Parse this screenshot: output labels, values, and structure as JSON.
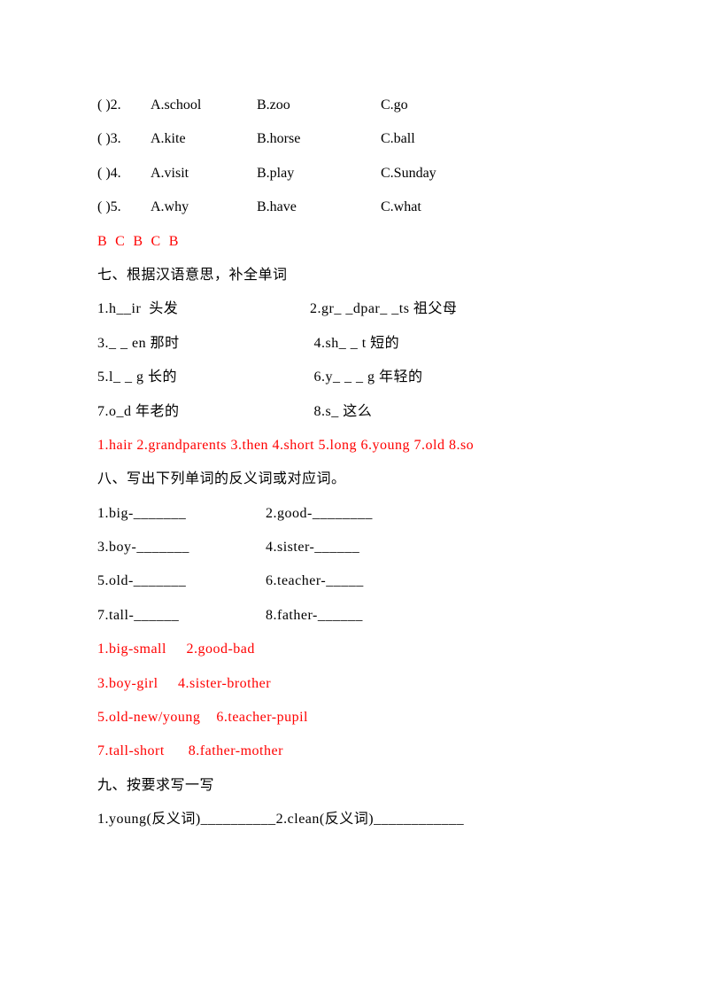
{
  "mcq": {
    "rows": [
      {
        "prefix": "( )2.",
        "a": "A.school",
        "b": "B.zoo",
        "c": "C.go"
      },
      {
        "prefix": "( )3.",
        "a": "A.kite",
        "b": "B.horse",
        "c": "C.ball"
      },
      {
        "prefix": "( )4.",
        "a": "A.visit",
        "b": "B.play",
        "c": "C.Sunday"
      },
      {
        "prefix": "( )5.",
        "a": "A.why",
        "b": "B.have",
        "c": "C.what"
      }
    ],
    "answer": "B  C  B  C  B"
  },
  "section7": {
    "title": "七、根据汉语意思，补全单词",
    "rows": [
      {
        "left": "1.h__ir  头发",
        "right": "2.gr_ _dpar_ _ts 祖父母"
      },
      {
        "left": "3._ _ en 那时",
        "right": " 4.sh_ _ t 短的"
      },
      {
        "left": "5.l_ _ g 长的",
        "right": " 6.y_ _ _ g 年轻的"
      },
      {
        "left": "7.o_d 年老的",
        "right": " 8.s_ 这么"
      }
    ],
    "answer": "1.hair 2.grandparents 3.then 4.short 5.long 6.young 7.old 8.so"
  },
  "section8": {
    "title": "八、写出下列单词的反义词或对应词。",
    "rows": [
      {
        "left": "1.big-_______",
        "right": "2.good-________"
      },
      {
        "left": "3.boy-_______",
        "right": "4.sister-______"
      },
      {
        "left": "5.old-_______",
        "right": "6.teacher-_____"
      },
      {
        "left": "7.tall-______",
        "right": "8.father-______"
      }
    ],
    "answers": [
      "1.big-small     2.good-bad",
      "3.boy-girl     4.sister-brother",
      "5.old-new/young    6.teacher-pupil",
      "7.tall-short      8.father-mother"
    ]
  },
  "section9": {
    "title": "九、按要求写一写",
    "row1": "1.young(反义词)__________2.clean(反义词)____________"
  }
}
